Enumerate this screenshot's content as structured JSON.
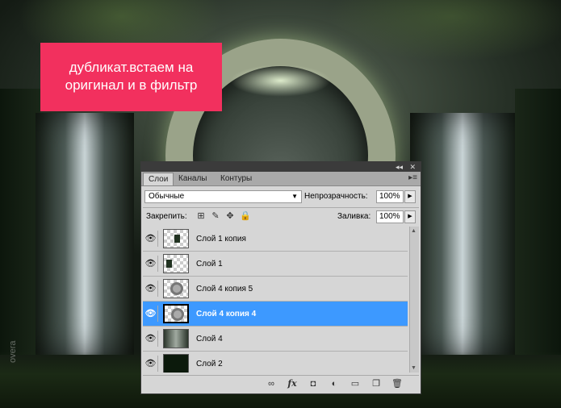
{
  "banner": {
    "text": "дубликат.встаем на оригинал и в фильтр"
  },
  "watermark": "overa",
  "panel": {
    "titlebar": {
      "collapse": "◂◂",
      "close": "✕"
    },
    "tabs": [
      {
        "label": "Слои",
        "active": true
      },
      {
        "label": "Каналы",
        "active": false
      },
      {
        "label": "Контуры",
        "active": false
      }
    ],
    "menu_icon": "menu-icon",
    "blend_mode": "Обычные",
    "opacity_label": "Непрозрачность:",
    "opacity_value": "100%",
    "lock_label": "Закрепить:",
    "lock_icons": [
      "lock-transparent-icon",
      "lock-brush-icon",
      "lock-move-icon",
      "lock-all-icon"
    ],
    "fill_label": "Заливка:",
    "fill_value": "100%",
    "layers": [
      {
        "name": "Слой 1 копия",
        "selected": false,
        "thumb": "checker-mark"
      },
      {
        "name": "Слой 1",
        "selected": false,
        "thumb": "checker-mark"
      },
      {
        "name": "Слой 4 копия 5",
        "selected": false,
        "thumb": "ring"
      },
      {
        "name": "Слой 4 копия 4",
        "selected": true,
        "thumb": "ring"
      },
      {
        "name": "Слой 4",
        "selected": false,
        "thumb": "scene"
      },
      {
        "name": "Слой 2",
        "selected": false,
        "thumb": "dark"
      }
    ],
    "bottom_icons": [
      "link-icon",
      "fx-icon",
      "mask-icon",
      "adjustment-icon",
      "folder-icon",
      "new-layer-icon",
      "trash-icon"
    ]
  },
  "colors": {
    "banner": "#f2305e",
    "selection": "#3d99ff",
    "panel": "#d6d6d6"
  }
}
